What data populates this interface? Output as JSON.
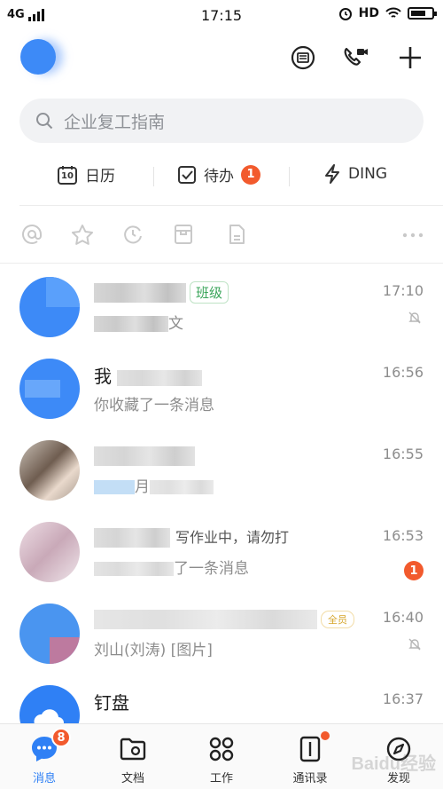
{
  "status_bar": {
    "network": "4G",
    "time": "17:15",
    "hd": "HD"
  },
  "header": {
    "icons": [
      "secret-chat-icon",
      "video-call-icon",
      "plus-icon"
    ]
  },
  "search": {
    "placeholder": "企业复工指南"
  },
  "quick_actions": [
    {
      "label": "日历",
      "icon": "calendar-icon",
      "icon_text": "10"
    },
    {
      "label": "待办",
      "icon": "todo-check-icon",
      "badge": "1"
    },
    {
      "label": "DING",
      "icon": "ding-bolt-icon"
    }
  ],
  "filters": [
    "at-icon",
    "star-icon",
    "clock-icon",
    "inbox-icon",
    "document-icon",
    "more-icon"
  ],
  "messages": [
    {
      "name": "",
      "tag": "班级",
      "preview": "文",
      "time": "17:10",
      "muted": true,
      "avatar_color": "#3d8af7"
    },
    {
      "name": "我",
      "preview": "你收藏了一条消息",
      "time": "16:56",
      "avatar_color": "#3d8af7"
    },
    {
      "name": "",
      "preview": "月",
      "time": "16:55",
      "avatar_color": "#9a8a7e"
    },
    {
      "name": "",
      "status": "写作业中，请勿打",
      "preview": "了一条消息",
      "time": "16:53",
      "badge": "1",
      "avatar_color": "#d9b8c6"
    },
    {
      "name": "",
      "tag": "全员",
      "preview": "刘山(刘涛)  [图片]",
      "time": "16:40",
      "muted": true,
      "avatar_color": "#4a95f0"
    },
    {
      "name": "钉盘",
      "preview": "",
      "time": "16:37",
      "avatar_color": "#2f80f5"
    }
  ],
  "tabs": [
    {
      "label": "消息",
      "icon": "message-icon",
      "badge": "8",
      "active": true
    },
    {
      "label": "文档",
      "icon": "folder-icon"
    },
    {
      "label": "工作",
      "icon": "apps-grid-icon"
    },
    {
      "label": "通讯录",
      "icon": "contacts-icon",
      "dot": true
    },
    {
      "label": "发现",
      "icon": "compass-icon"
    }
  ],
  "watermark": "Baidu经验"
}
